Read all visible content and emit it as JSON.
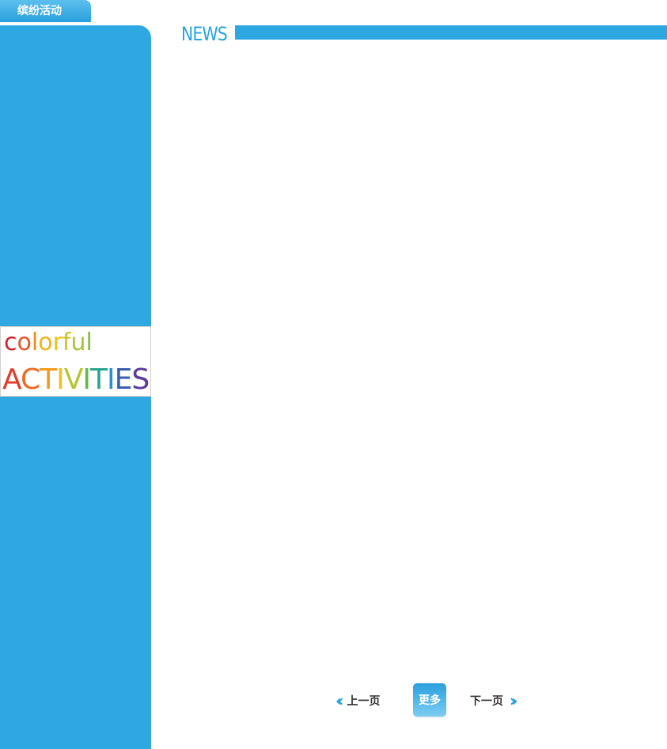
{
  "tab": {
    "label": "缤纷活动"
  },
  "sidebar": {
    "banner_line1_letters": [
      {
        "ch": "c",
        "color": "#d9202a"
      },
      {
        "ch": "o",
        "color": "#e8542a"
      },
      {
        "ch": "l",
        "color": "#f08a1f"
      },
      {
        "ch": "o",
        "color": "#f5b21a"
      },
      {
        "ch": "r",
        "color": "#e9c21b"
      },
      {
        "ch": "f",
        "color": "#cfc32a"
      },
      {
        "ch": "u",
        "color": "#a9c43a"
      },
      {
        "ch": "l",
        "color": "#86bf3c"
      }
    ],
    "banner_line2_letters": [
      {
        "ch": "A",
        "color": "#e23b2a"
      },
      {
        "ch": "C",
        "color": "#ee6a22"
      },
      {
        "ch": "T",
        "color": "#f39a1c"
      },
      {
        "ch": "I",
        "color": "#f3be1b"
      },
      {
        "ch": "V",
        "color": "#b7c733"
      },
      {
        "ch": "I",
        "color": "#5fba46"
      },
      {
        "ch": "T",
        "color": "#2aa58f"
      },
      {
        "ch": "I",
        "color": "#2a8fcf"
      },
      {
        "ch": "E",
        "color": "#3a5fb0"
      },
      {
        "ch": "S",
        "color": "#5a3a9a"
      }
    ]
  },
  "news": {
    "title": "NEWS",
    "accent": "#2ea6e0"
  },
  "pager": {
    "prev_label": "上一页",
    "more_label": "更多",
    "next_label": "下一页"
  }
}
